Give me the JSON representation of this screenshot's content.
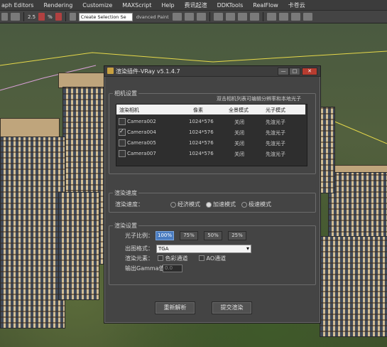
{
  "menubar": {
    "items": [
      "aph Editors",
      "Rendering",
      "Customize",
      "MAXScript",
      "Help",
      "费讯起渲",
      "DDKTools",
      "RealFlow",
      "卡苍云"
    ]
  },
  "toolbar": {
    "selection_set_placeholder": "Create Selection Se",
    "advanced_paint": "dvanced Paint",
    "snap_label": "2.5",
    "percent_label": "%"
  },
  "dialog": {
    "title": "渲染插件-VRay v5.1.4.7",
    "window_buttons": {
      "minimize": "—",
      "maximize": "□",
      "close": "✕"
    },
    "camera_group": {
      "title": "相机设置",
      "hint": "双击相机列表可编辑分辨率和本地光子",
      "columns": [
        "渲染相机",
        "像素",
        "全景模式",
        "光子模式"
      ],
      "rows": [
        {
          "checked": false,
          "camera": "Camera002",
          "pixels": "1024*576",
          "panorama": "关闭",
          "photon": "先渲光子"
        },
        {
          "checked": true,
          "camera": "Camera004",
          "pixels": "1024*576",
          "panorama": "关闭",
          "photon": "先渲光子"
        },
        {
          "checked": false,
          "camera": "Camera005",
          "pixels": "1024*576",
          "panorama": "关闭",
          "photon": "先渲光子"
        },
        {
          "checked": false,
          "camera": "Camera007",
          "pixels": "1024*576",
          "panorama": "关闭",
          "photon": "先渲光子"
        }
      ]
    },
    "speed_group": {
      "title": "渲染速度",
      "label": "渲染速度：",
      "options": [
        "经济模式",
        "加速模式",
        "极速模式"
      ],
      "selected_index": 1
    },
    "render_group": {
      "title": "渲染设置",
      "photon_ratio_label": "光子比例：",
      "photon_ratios": [
        "100%",
        "75%",
        "50%",
        "25%"
      ],
      "photon_ratio_selected": 0,
      "format_label": "出图格式：",
      "format_value": "TGA",
      "elements_label": "渲染元素：",
      "element_color": "色彩通道",
      "element_ao": "AO通道",
      "gamma_label": "输出Gamma值：",
      "gamma_value": "0.0"
    },
    "buttons": {
      "reparse": "重新解析",
      "submit": "提交渲染"
    }
  },
  "colors": {
    "dialog_bg": "#444444",
    "active_ratio": "#4a7cc0",
    "close_button": "#b73c30"
  }
}
